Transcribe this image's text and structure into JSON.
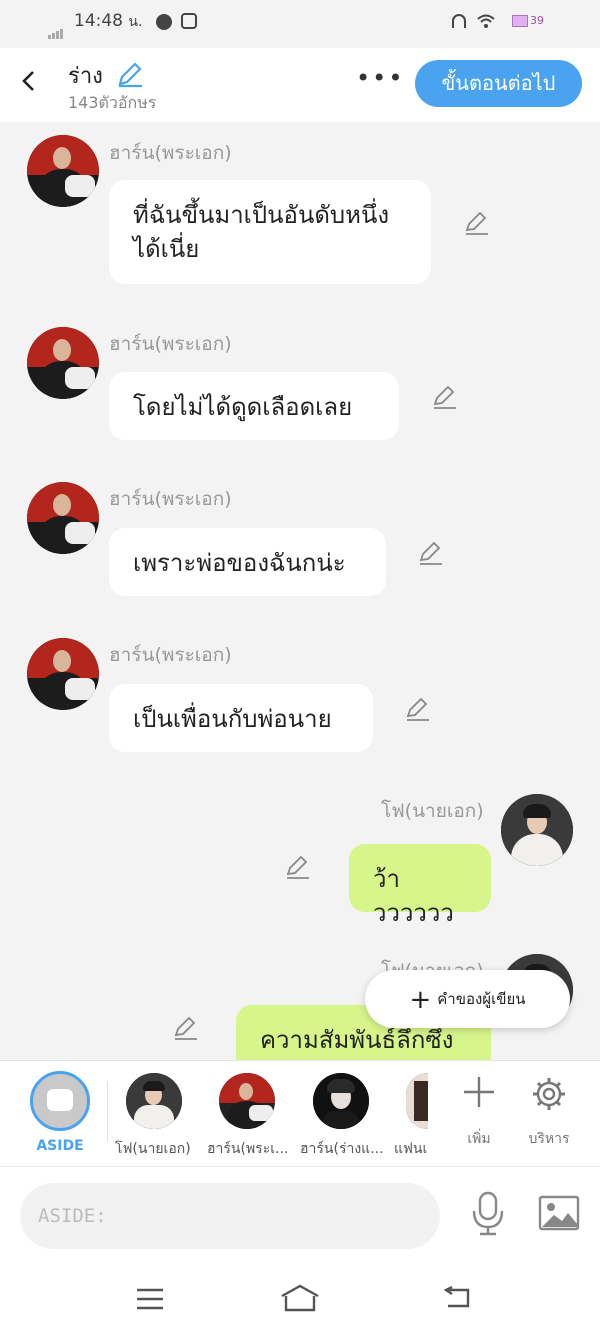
{
  "status": {
    "time": "14:48",
    "time_suffix": "น.",
    "battery": "39"
  },
  "header": {
    "title": "ร่าง",
    "subtitle": "143ตัวอักษร",
    "more": "•••",
    "next_label": "ขั้นตอนต่อไป"
  },
  "messages": [
    {
      "sender": "ฮาร์น(พระเอก)",
      "text": "ที่ฉันขึ้นมาเป็นอันดับหนึ่ง\nได้เนี่ย",
      "side": "left"
    },
    {
      "sender": "ฮาร์น(พระเอก)",
      "text": "โดยไม่ได้ดูดเลือดเลย",
      "side": "left"
    },
    {
      "sender": "ฮาร์น(พระเอก)",
      "text": "เพราะพ่อของฉันกน่ะ",
      "side": "left"
    },
    {
      "sender": "ฮาร์น(พระเอก)",
      "text": "เป็นเพื่อนกับพ่อนาย",
      "side": "left"
    },
    {
      "sender": "โฟ(นายเอก)",
      "text": "ว้าวววววว",
      "side": "right"
    },
    {
      "sender": "โฟ(นายเอก)",
      "text": "ความสัมพันธ์ลึกซึ้ง",
      "side": "right"
    }
  ],
  "fab": {
    "label": "คำของผู้เขียน",
    "plus": "+"
  },
  "characters": {
    "aside_label": "ASIDE",
    "items": [
      {
        "label": "โฟ(นายเอก)"
      },
      {
        "label": "ฮาร์น(พระเ..."
      },
      {
        "label": "ฮาร์น(ร่างแ..."
      },
      {
        "label": "แฟนเ"
      }
    ],
    "add_label": "เพิ่ม",
    "manage_label": "บริหาร"
  },
  "input": {
    "placeholder": "ASIDE:"
  },
  "icons": {
    "back": "chevron-left-icon",
    "edit": "pencil-icon",
    "mic": "microphone-icon",
    "image": "image-icon",
    "gear": "gear-icon"
  },
  "colors": {
    "accent": "#4aa3ee",
    "my_bubble": "#d6f58b",
    "bubble": "#ffffff",
    "background": "#f3f3f3"
  }
}
